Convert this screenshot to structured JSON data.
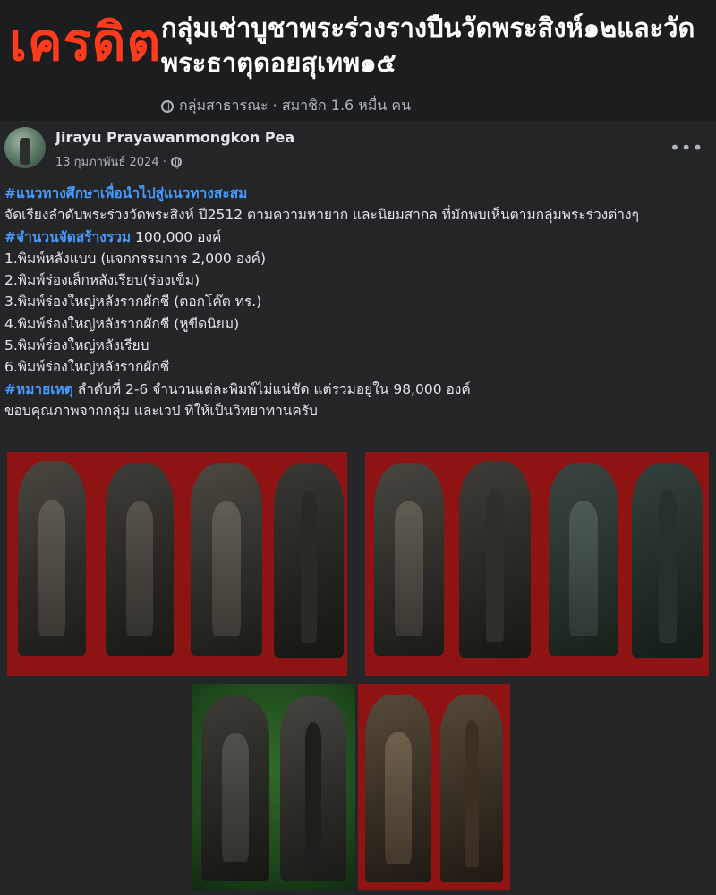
{
  "group": {
    "credit_label": "เครดิต",
    "title": "กลุ่มเช่าบูชาพระร่วงรางปืนวัดพระสิงห์๑๒และวัดพระธาตุดอยสุเทพ๑๕",
    "meta": "กลุ่มสาธารณะ · สมาชิก 1.6 หมื่น คน"
  },
  "post": {
    "author": "Jirayu Prayawanmongkon Pea",
    "date": "13 กุมภาพันธ์ 2024 ·",
    "more_icon": "more-dots-icon",
    "lines": [
      {
        "tag": "#แนวทางศึกษาเพื่อนำไปสู่แนวทางสะสม",
        "text": ""
      },
      {
        "tag": "",
        "text": "จัดเรียงลำดับพระร่วงวัดพระสิงห์ ปี2512 ตามความหายาก และนิยมสากล ที่มักพบเห็นตามกลุ่มพระร่วงต่างๆ"
      },
      {
        "tag": "#จำนวนจัดสร้างรวม",
        "text": " 100,000 องค์"
      },
      {
        "tag": "",
        "text": "1.พิมพ์หลังแบบ (แจกกรรมการ 2,000 องค์)"
      },
      {
        "tag": "",
        "text": "2.พิมพ์ร่องเล็กหลังเรียบ(ร่องเข็ม)"
      },
      {
        "tag": "",
        "text": "3.พิมพ์ร่องใหญ่หลังรากผักชี (ตอกโค๊ต ทร.)"
      },
      {
        "tag": "",
        "text": "4.พิมพ์ร่องใหญ่หลังรากผักชี (หูขีดนิยม)"
      },
      {
        "tag": "",
        "text": "5.พิมพ์ร่องใหญ่หลังเรียบ"
      },
      {
        "tag": "",
        "text": "6.พิมพ์ร่องใหญ่หลังรากผักชี"
      },
      {
        "tag": "#หมายเหตุ",
        "text": " ลำดับที่ 2-6 จำนวนแต่ละพิมพ์ไม่แน่ชัด แต่รวมอยู่ใน 98,000 องค์"
      },
      {
        "tag": "",
        "text": "ขอบคุณภาพจากกลุ่ม และเวป ที่ให้เป็นวิทยาทานครับ"
      }
    ]
  },
  "colors": {
    "background": "#242526",
    "hashtag": "#4599ff",
    "credit": "#ff3b1d",
    "photo_red": "#8e1414",
    "photo_green": "#1f4a1c"
  }
}
